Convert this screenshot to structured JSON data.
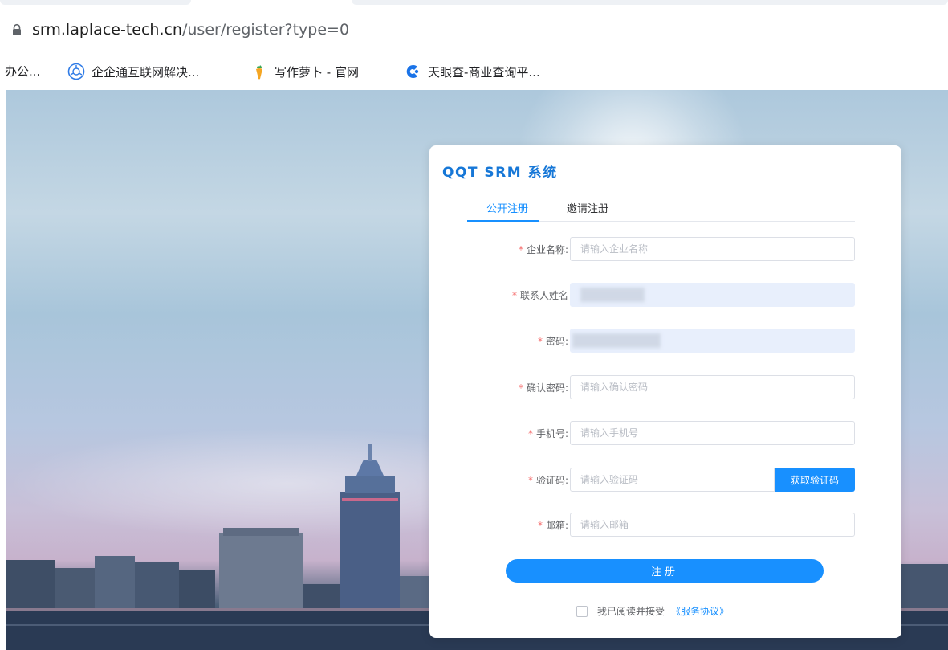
{
  "browser": {
    "url_host": "srm.laplace-tech.cn",
    "url_path": "/user/register?type=0"
  },
  "bookmarks": [
    {
      "label": "办公...",
      "icon": "none"
    },
    {
      "label": "企企通互联网解决...",
      "icon": "compass-icon"
    },
    {
      "label": "写作萝卜 - 官网",
      "icon": "carrot-icon"
    },
    {
      "label": "天眼查-商业查询平...",
      "icon": "tianyancha-icon"
    }
  ],
  "card": {
    "title": "QQT SRM 系统",
    "tabs": [
      {
        "label": "公开注册",
        "active": true
      },
      {
        "label": "邀请注册",
        "active": false
      }
    ],
    "fields": {
      "company_name": {
        "label": "企业名称:",
        "placeholder": "请输入企业名称",
        "value": ""
      },
      "contact_name": {
        "label": "联系人姓名",
        "placeholder": "",
        "value": ""
      },
      "password": {
        "label": "密码:",
        "placeholder": "",
        "value": ""
      },
      "confirm_password": {
        "label": "确认密码:",
        "placeholder": "请输入确认密码",
        "value": ""
      },
      "phone": {
        "label": "手机号:",
        "placeholder": "请输入手机号",
        "value": ""
      },
      "code": {
        "label": "验证码:",
        "placeholder": "请输入验证码",
        "value": ""
      },
      "email": {
        "label": "邮箱:",
        "placeholder": "请输入邮箱",
        "value": ""
      }
    },
    "required_mark": "*",
    "get_code_button": "获取验证码",
    "submit_button": "注册",
    "agreement_text": "我已阅读并接受",
    "agreement_link": "《服务协议》"
  },
  "colors": {
    "primary": "#1890ff",
    "title_blue": "#1677d7",
    "required": "#f56c6c",
    "autofill": "#e8effc"
  }
}
